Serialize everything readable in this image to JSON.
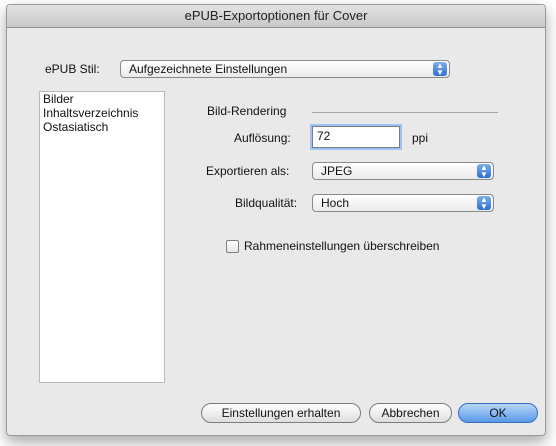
{
  "window": {
    "title": "ePUB-Exportoptionen für Cover"
  },
  "style": {
    "label": "ePUB Stil:",
    "value": "Aufgezeichnete Einstellungen"
  },
  "sidebar": {
    "items": [
      {
        "label": "Bilder"
      },
      {
        "label": "Inhaltsverzeichnis"
      },
      {
        "label": "Ostasiatisch"
      }
    ]
  },
  "section": {
    "title": "Bild-Rendering"
  },
  "resolution": {
    "label": "Auflösung:",
    "value": "72",
    "unit": "ppi"
  },
  "export_as": {
    "label": "Exportieren als:",
    "value": "JPEG"
  },
  "quality": {
    "label": "Bildqualität:",
    "value": "Hoch"
  },
  "frame_override": {
    "label": "Rahmeneinstellungen überschreiben",
    "checked": false
  },
  "buttons": {
    "keep": "Einstellungen erhalten",
    "cancel": "Abbrechen",
    "ok": "OK"
  },
  "colors": {
    "accent": "#5a98e6",
    "window_bg": "#e9e9e9"
  },
  "icons": {
    "popup_arrows": "up-down-arrows-icon"
  }
}
